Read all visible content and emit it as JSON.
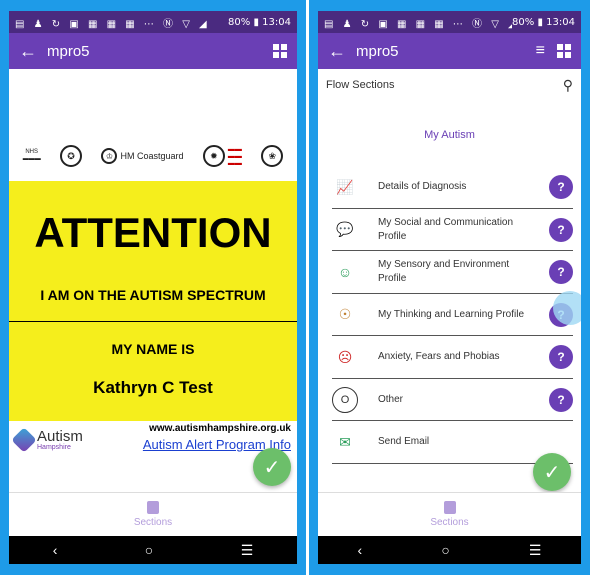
{
  "status": {
    "battery": "80%",
    "time": "13:04"
  },
  "left": {
    "appbar": {
      "title": "mpro5"
    },
    "logos": {
      "coastguard": "HM Coastguard"
    },
    "card": {
      "attention": "ATTENTION",
      "spectrum": "I AM ON THE AUTISM SPECTRUM",
      "my_name_is": "MY NAME IS",
      "name": "Kathryn C Test"
    },
    "footer": {
      "brand": "Autism",
      "brand_sub": "Hampshire",
      "url": "www.autismhampshire.org.uk",
      "link": "Autism Alert Program Info"
    },
    "bottom_tab": "Sections"
  },
  "right": {
    "appbar": {
      "title": "mpro5"
    },
    "flow_label": "Flow Sections",
    "section_head": "My Autism",
    "items": [
      {
        "label": "Details of Diagnosis",
        "icon": "diagnosis-icon",
        "glyph": "📈",
        "help": "?"
      },
      {
        "label": "My Social and Communication Profile",
        "icon": "chat-icon",
        "glyph": "💬",
        "help": "?"
      },
      {
        "label": "My Sensory and Environment Profile",
        "icon": "sensory-icon",
        "glyph": "☺",
        "help": "?"
      },
      {
        "label": "My Thinking and Learning Profile",
        "icon": "thinking-head-icon",
        "glyph": "☉",
        "help": "?"
      },
      {
        "label": "Anxiety, Fears and Phobias",
        "icon": "anxiety-head-icon",
        "glyph": "☹",
        "help": "?"
      },
      {
        "label": "Other",
        "icon": "other-icon",
        "glyph": "O",
        "help": "?"
      },
      {
        "label": "Send Email",
        "icon": "email-icon",
        "glyph": "✉",
        "help": ""
      }
    ],
    "bottom_tab": "Sections"
  },
  "colors": {
    "status_bar": "#4a2a80",
    "app_bar": "#6a3fb5",
    "card_yellow": "#f5ee1c",
    "fab_green": "#6cbf6a",
    "frame_blue": "#1e9be8"
  }
}
